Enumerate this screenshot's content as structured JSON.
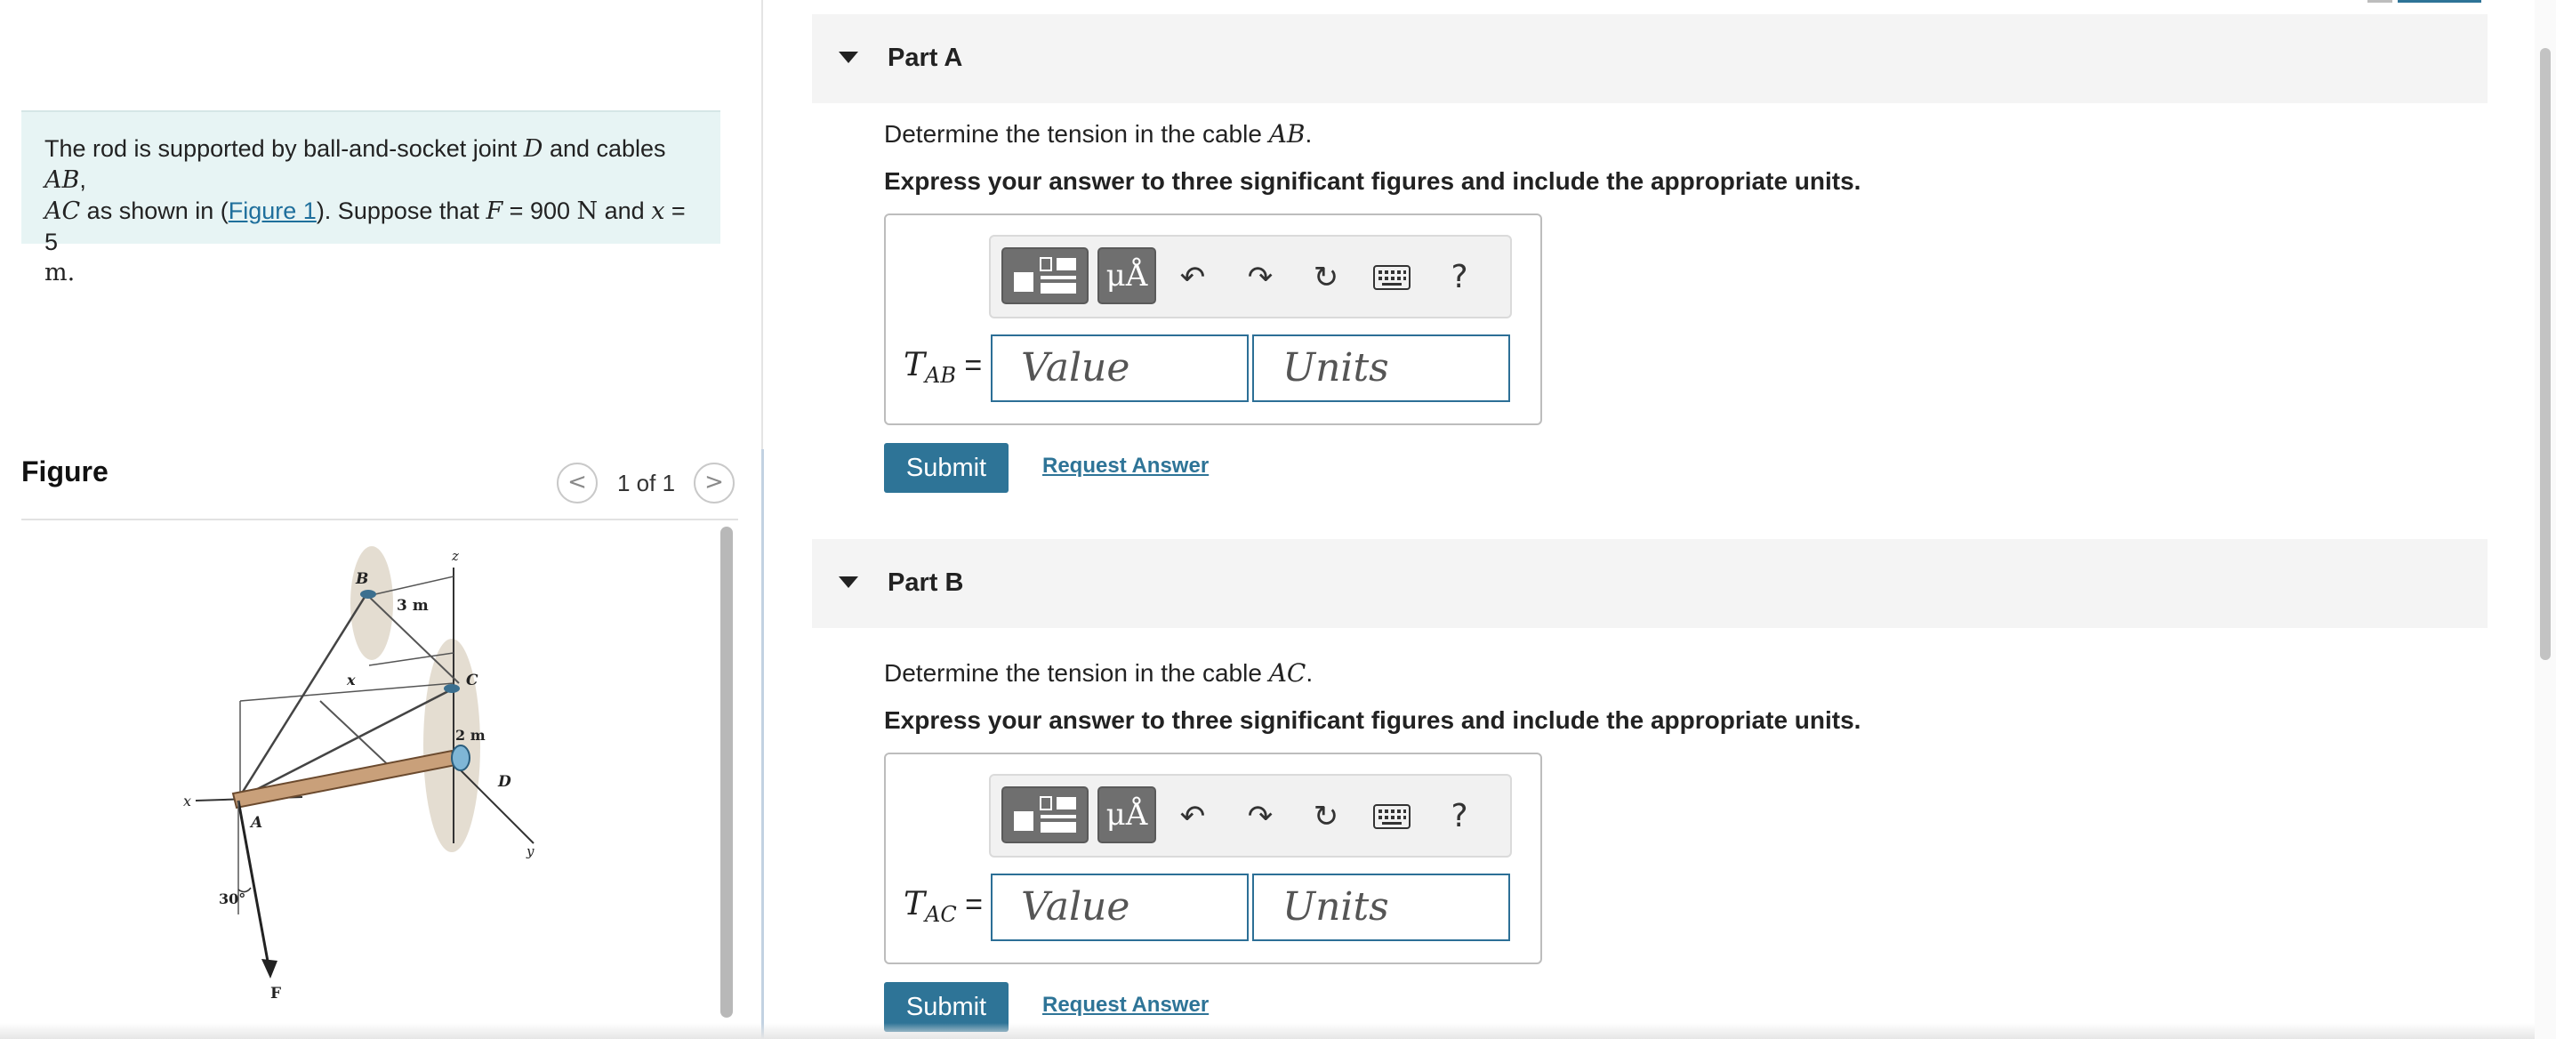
{
  "problem": {
    "text_1": "The rod is supported by ball-and-socket joint ",
    "D": "D",
    "text_2": " and cables ",
    "AB": "AB",
    "comma": ",",
    "AC": "AC",
    "text_3": " as shown in (",
    "figure_link": "Figure 1",
    "text_4": "). Suppose that ",
    "F": "F",
    "eq1": " = 900 ",
    "N": "N",
    "text_5": " and ",
    "x": "x",
    "eq2": " = 5",
    "m": "m."
  },
  "figure": {
    "title": "Figure",
    "counter": "1 of 1",
    "prev_glyph": "<",
    "next_glyph": ">",
    "labels": {
      "B": "B",
      "z": "z",
      "three_m": "3 m",
      "x_top": "x",
      "C": "C",
      "two_m": "2 m",
      "D": "D",
      "x_axis": "x",
      "A": "A",
      "y": "y",
      "angle": "30°",
      "F": "F"
    }
  },
  "parts": [
    {
      "title": "Part A",
      "question_prefix": "Determine the tension in the cable ",
      "cable": "AB",
      "question_suffix": ".",
      "instruction": "Express your answer to three significant figures and include the appropriate units.",
      "label_T": "T",
      "label_sub": "AB",
      "label_eq": " =",
      "value_placeholder": "Value",
      "units_placeholder": "Units",
      "submit": "Submit",
      "request": "Request Answer"
    },
    {
      "title": "Part B",
      "question_prefix": "Determine the tension in the cable ",
      "cable": "AC",
      "question_suffix": ".",
      "instruction": "Express your answer to three significant figures and include the appropriate units.",
      "label_T": "T",
      "label_sub": "AC",
      "label_eq": " =",
      "value_placeholder": "Value",
      "units_placeholder": "Units",
      "submit": "Submit",
      "request": "Request Answer"
    }
  ],
  "toolbar": {
    "units_glyph": "μÅ",
    "undo_glyph": "↶",
    "redo_glyph": "↷",
    "reset_glyph": "↻",
    "help_glyph": "?",
    "icons": [
      "templates-icon",
      "units-icon",
      "undo-icon",
      "redo-icon",
      "reset-icon",
      "keyboard-icon",
      "help-icon"
    ]
  },
  "colors": {
    "accent": "#2e7497",
    "problem_bg": "#e7f4f4",
    "part_header_bg": "#f4f4f4",
    "input_border": "#2c6f96"
  }
}
